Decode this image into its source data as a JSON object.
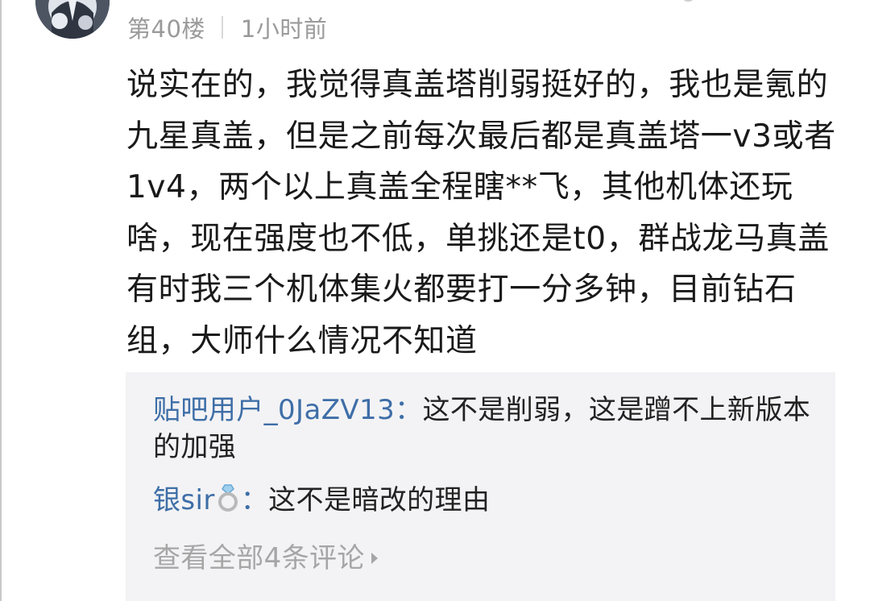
{
  "post": {
    "floor": "第40楼",
    "time": "1小时前",
    "content": "说实在的，我觉得真盖塔削弱挺好的，我也是氪的九星真盖，但是之前每次最后都是真盖塔一v3或者1v4，两个以上真盖全程瞎**飞，其他机体还玩啥，现在强度也不低，单挑还是t0，群战龙马真盖有时我三个机体集火都要打一分多钟，目前钻石组，大师什么情况不知道"
  },
  "replies": [
    {
      "user": "贴吧用户_0JaZV13",
      "separator": "：",
      "text": "这不是削弱，这是蹭不上新版本的加强"
    },
    {
      "user": "银sir",
      "user_icon": "ring-icon",
      "separator": "：",
      "text": "这不是暗改的理由"
    }
  ],
  "view_all": "查看全部4条评论",
  "icons": {
    "avatar": "avatar",
    "more": "more-icon",
    "chevron": "chevron-right-icon"
  },
  "colors": {
    "username": "#3e6ea7",
    "meta": "#9a9a9a",
    "reply_bg": "#f3f3f5"
  }
}
